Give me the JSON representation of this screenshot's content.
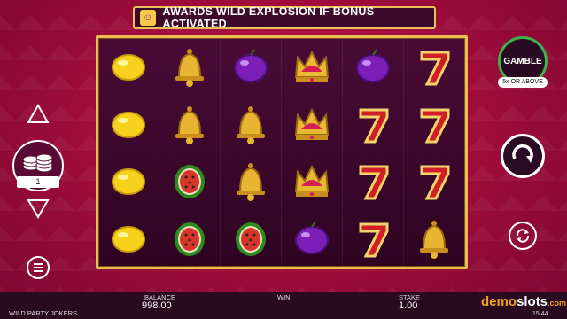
{
  "banner": {
    "text": "AWARDS WILD EXPLOSION IF BONUS ACTIVATED",
    "icon": "joker-icon"
  },
  "reels": {
    "columns": 6,
    "rows": 4,
    "symbols": [
      [
        "lemon",
        "lemon",
        "lemon",
        "lemon"
      ],
      [
        "bell",
        "bell",
        "watermelon",
        "watermelon"
      ],
      [
        "plum",
        "bell",
        "bell",
        "watermelon"
      ],
      [
        "crown",
        "crown",
        "crown",
        "plum"
      ],
      [
        "plum",
        "seven",
        "seven",
        "seven"
      ],
      [
        "seven",
        "seven",
        "seven",
        "bell"
      ]
    ]
  },
  "bet": {
    "chip_value": "1"
  },
  "gamble": {
    "label": "GAMBLE",
    "sub": "5x OR ABOVE"
  },
  "footer": {
    "game_name": "WILD PARTY JOKERS",
    "balance_label": "BALANCE",
    "balance_value": "998.00",
    "win_label": "WIN",
    "stake_label": "STAKE",
    "stake_value": "1.00",
    "logo_demo": "demo",
    "logo_slots": "slots",
    "logo_com": ".com",
    "time": "15:44"
  },
  "colors": {
    "accent_gold": "#e8bf4e",
    "background": "#a30d3d",
    "gamble_ring": "#3fb24b"
  }
}
